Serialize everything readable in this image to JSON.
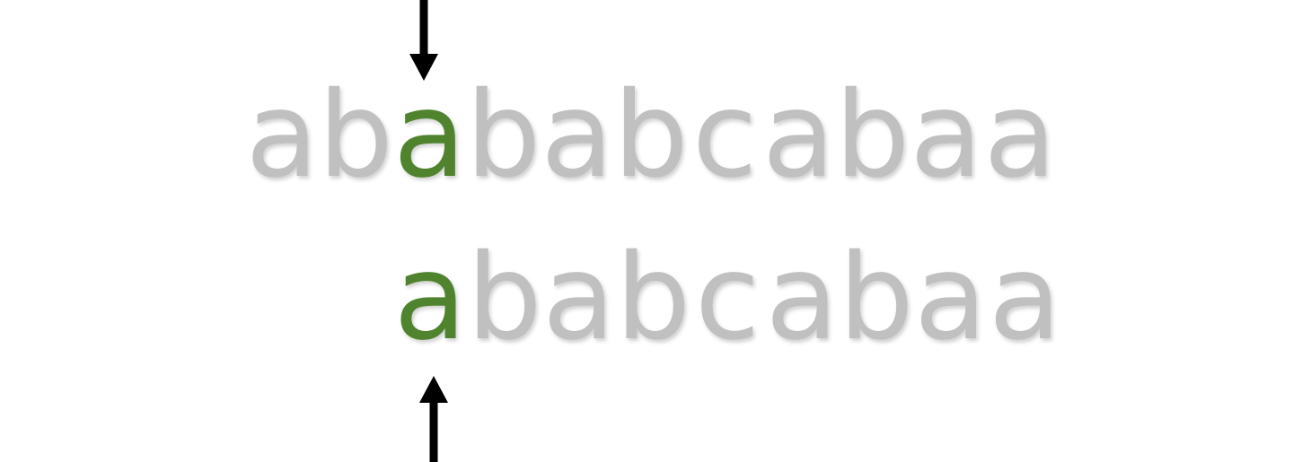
{
  "colors": {
    "background": "#ffffff",
    "inactive_char": "#c0c0c0",
    "highlight_char": "#4f832e",
    "arrow": "#000000"
  },
  "text_string": {
    "chars": [
      "a",
      "b",
      "a",
      "b",
      "a",
      "b",
      "c",
      "a",
      "b",
      "a",
      "a"
    ],
    "highlight_index": 2
  },
  "pattern": {
    "chars": [
      "a",
      "b",
      "a",
      "b",
      "c",
      "a",
      "b",
      "a",
      "a"
    ],
    "highlight_index": 0
  },
  "icons": {
    "top_pointer": "arrow-down-icon",
    "bottom_pointer": "arrow-up-icon"
  }
}
